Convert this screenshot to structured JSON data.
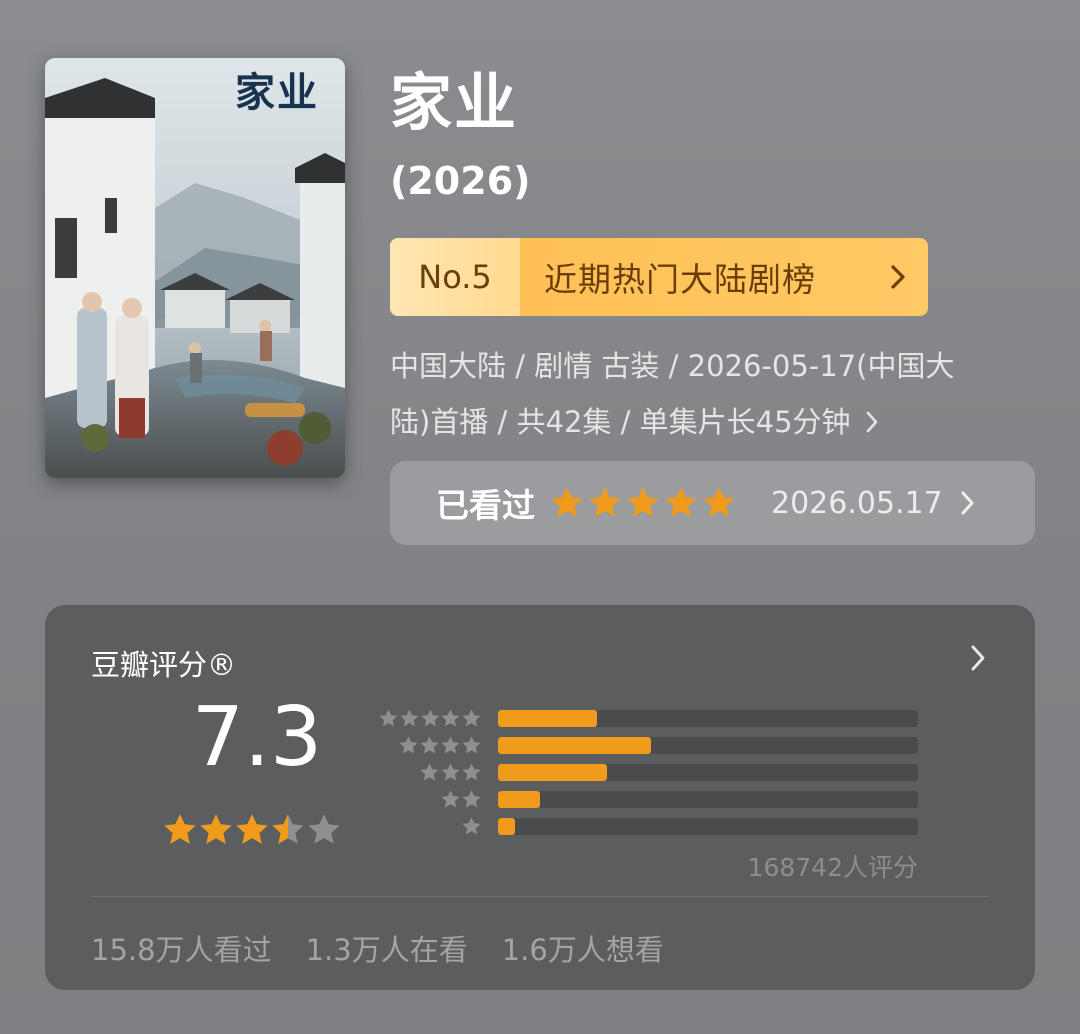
{
  "poster": {
    "title_text": "家业",
    "icon": "drama-poster-image"
  },
  "header": {
    "title": "家业",
    "year": "(2026)"
  },
  "ranking": {
    "number": "No.5",
    "label": "近期热门大陆剧榜",
    "colors": {
      "accent": "#ffc25a",
      "text": "#6b3e08"
    }
  },
  "meta": {
    "line1": "中国大陆 / 剧情 古装 / 2026-05-17(中国大",
    "line2": "陆)首播 / 共42集 / 单集片长45分钟"
  },
  "watched": {
    "label": "已看过",
    "stars": 5,
    "date": "2026.05.17"
  },
  "rating_card": {
    "title": "豆瓣评分®",
    "score": "7.3",
    "stars": 3.5,
    "distribution": [
      {
        "stars": 5,
        "fraction": 0.235
      },
      {
        "stars": 4,
        "fraction": 0.365
      },
      {
        "stars": 3,
        "fraction": 0.26
      },
      {
        "stars": 2,
        "fraction": 0.1
      },
      {
        "stars": 1,
        "fraction": 0.04
      }
    ],
    "rating_count": "168742人评分",
    "stats": [
      "15.8万人看过",
      "1.3万人在看",
      "1.6万人想看"
    ],
    "colors": {
      "star": "#f19b1c",
      "star_empty": "#8e8f91",
      "bar_small_star": "#8e8f91"
    }
  }
}
